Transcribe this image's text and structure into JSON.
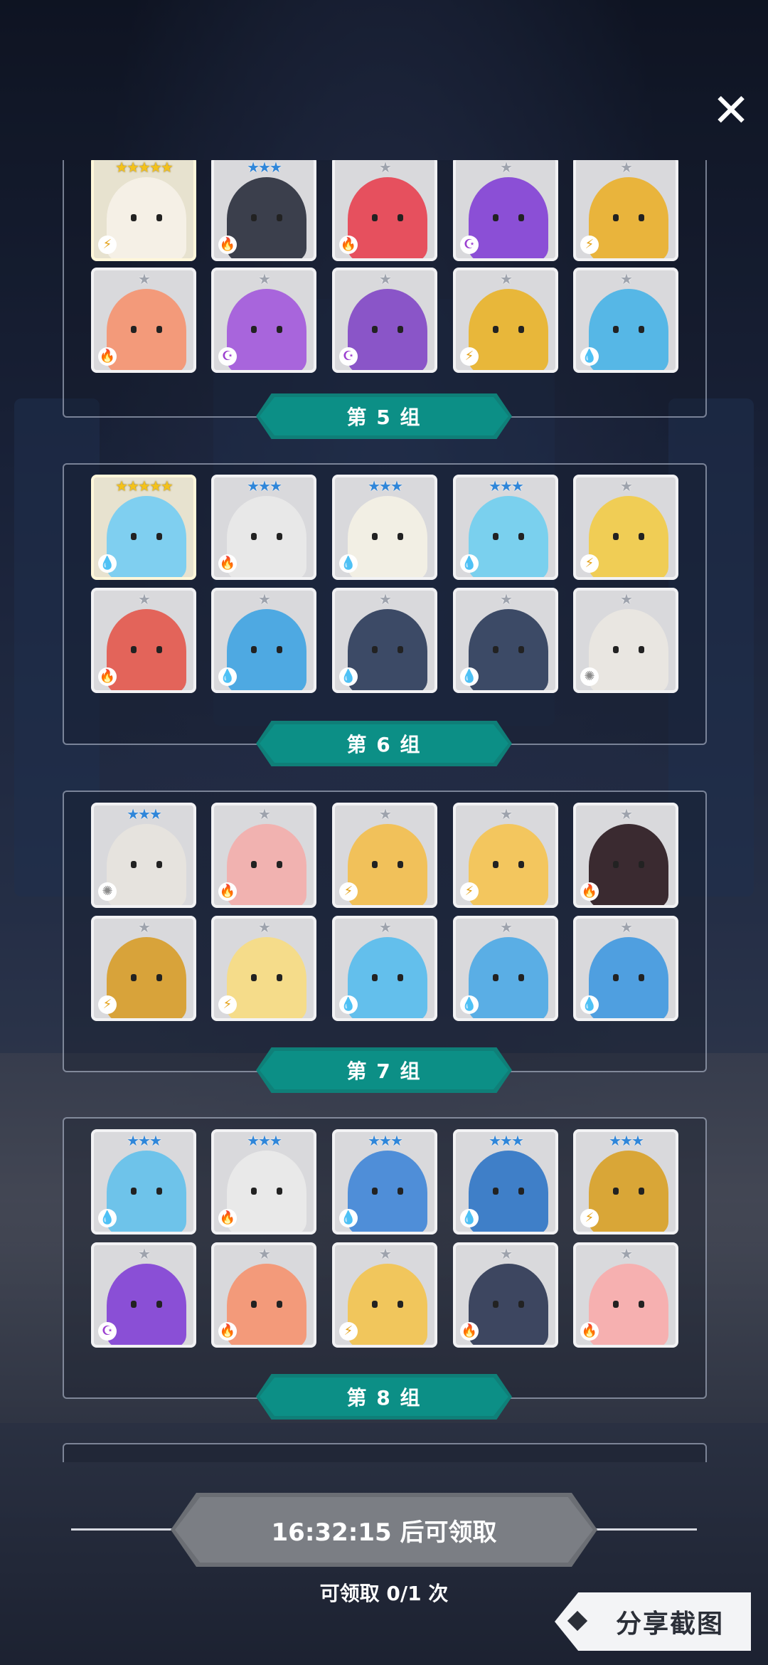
{
  "header": {
    "close_icon": "close-icon"
  },
  "groups": [
    {
      "label": "第 5 组"
    },
    {
      "label": "第 6 组"
    },
    {
      "label": "第 7 组"
    },
    {
      "label": "第 8 组"
    }
  ],
  "element_icons": {
    "fire": "🔥",
    "water": "💧",
    "thunder": "⚡",
    "dark": "☪",
    "light": "✺"
  },
  "rows": [
    {
      "group": 5,
      "row": 1,
      "cards": [
        {
          "stars": "★★★★★",
          "rank": "gold",
          "element": "thunder",
          "color": "#f5f0e6"
        },
        {
          "stars": "★★★",
          "rank": "blue",
          "element": "fire",
          "color": "#3b3f4c"
        },
        {
          "stars": "★",
          "rank": "gray",
          "element": "fire",
          "color": "#e6505e"
        },
        {
          "stars": "★",
          "rank": "gray",
          "element": "dark",
          "color": "#8b4fd6"
        },
        {
          "stars": "★",
          "rank": "gray",
          "element": "thunder",
          "color": "#e9b43c"
        }
      ]
    },
    {
      "group": 5,
      "row": 2,
      "cards": [
        {
          "stars": "★",
          "rank": "gray",
          "element": "fire",
          "color": "#f39a7a"
        },
        {
          "stars": "★",
          "rank": "gray",
          "element": "dark",
          "color": "#a865dc"
        },
        {
          "stars": "★",
          "rank": "gray",
          "element": "dark",
          "color": "#8a55c8"
        },
        {
          "stars": "★",
          "rank": "gray",
          "element": "thunder",
          "color": "#e8b73a"
        },
        {
          "stars": "★",
          "rank": "gray",
          "element": "water",
          "color": "#56b7e6"
        }
      ]
    },
    {
      "group": 6,
      "row": 1,
      "cards": [
        {
          "stars": "★★★★★",
          "rank": "gold",
          "element": "water",
          "color": "#7fcff0"
        },
        {
          "stars": "★★★",
          "rank": "blue",
          "element": "fire",
          "color": "#e8e8e8"
        },
        {
          "stars": "★★★",
          "rank": "blue",
          "element": "water",
          "color": "#f2efe4"
        },
        {
          "stars": "★★★",
          "rank": "blue",
          "element": "water",
          "color": "#7ad0ee"
        },
        {
          "stars": "★",
          "rank": "gray",
          "element": "thunder",
          "color": "#f0cd55"
        }
      ]
    },
    {
      "group": 6,
      "row": 2,
      "cards": [
        {
          "stars": "★",
          "rank": "gray",
          "element": "fire",
          "color": "#e3645a"
        },
        {
          "stars": "★",
          "rank": "gray",
          "element": "water",
          "color": "#4ea9e2"
        },
        {
          "stars": "★",
          "rank": "gray",
          "element": "water",
          "color": "#3c4a66"
        },
        {
          "stars": "★",
          "rank": "gray",
          "element": "water",
          "color": "#3c4a66"
        },
        {
          "stars": "★",
          "rank": "gray",
          "element": "light",
          "color": "#e9e6e1"
        }
      ]
    },
    {
      "group": 7,
      "row": 1,
      "cards": [
        {
          "stars": "★★★",
          "rank": "blue",
          "element": "light",
          "color": "#e6e3de"
        },
        {
          "stars": "★",
          "rank": "gray",
          "element": "fire",
          "color": "#f1b2b0"
        },
        {
          "stars": "★",
          "rank": "gray",
          "element": "thunder",
          "color": "#f1c15a"
        },
        {
          "stars": "★",
          "rank": "gray",
          "element": "thunder",
          "color": "#f3c65e"
        },
        {
          "stars": "★",
          "rank": "gray",
          "element": "fire",
          "color": "#3a2a30"
        }
      ]
    },
    {
      "group": 7,
      "row": 2,
      "cards": [
        {
          "stars": "★",
          "rank": "gray",
          "element": "thunder",
          "color": "#d8a33a"
        },
        {
          "stars": "★",
          "rank": "gray",
          "element": "thunder",
          "color": "#f5dc8a"
        },
        {
          "stars": "★",
          "rank": "gray",
          "element": "water",
          "color": "#63bfec"
        },
        {
          "stars": "★",
          "rank": "gray",
          "element": "water",
          "color": "#5aaee5"
        },
        {
          "stars": "★",
          "rank": "gray",
          "element": "water",
          "color": "#4f9fe0"
        }
      ]
    },
    {
      "group": 8,
      "row": 1,
      "cards": [
        {
          "stars": "★★★",
          "rank": "blue",
          "element": "water",
          "color": "#6ec3ea"
        },
        {
          "stars": "★★★",
          "rank": "blue",
          "element": "fire",
          "color": "#e9e9e9"
        },
        {
          "stars": "★★★",
          "rank": "blue",
          "element": "water",
          "color": "#4f8ed8"
        },
        {
          "stars": "★★★",
          "rank": "blue",
          "element": "water",
          "color": "#3f7fc8"
        },
        {
          "stars": "★★★",
          "rank": "blue",
          "element": "thunder",
          "color": "#d9a637"
        }
      ]
    },
    {
      "group": 8,
      "row": 2,
      "cards": [
        {
          "stars": "★",
          "rank": "gray",
          "element": "dark",
          "color": "#8a4fd6"
        },
        {
          "stars": "★",
          "rank": "gray",
          "element": "fire",
          "color": "#f39a7a"
        },
        {
          "stars": "★",
          "rank": "gray",
          "element": "thunder",
          "color": "#f1c65c"
        },
        {
          "stars": "★",
          "rank": "gray",
          "element": "fire",
          "color": "#3d4660"
        },
        {
          "stars": "★",
          "rank": "gray",
          "element": "fire",
          "color": "#f6b0b0"
        }
      ]
    }
  ],
  "footer": {
    "timer_label": "16:32:15 后可领取",
    "claim_count": "可领取 0/1 次",
    "share_label": "分享截图"
  }
}
